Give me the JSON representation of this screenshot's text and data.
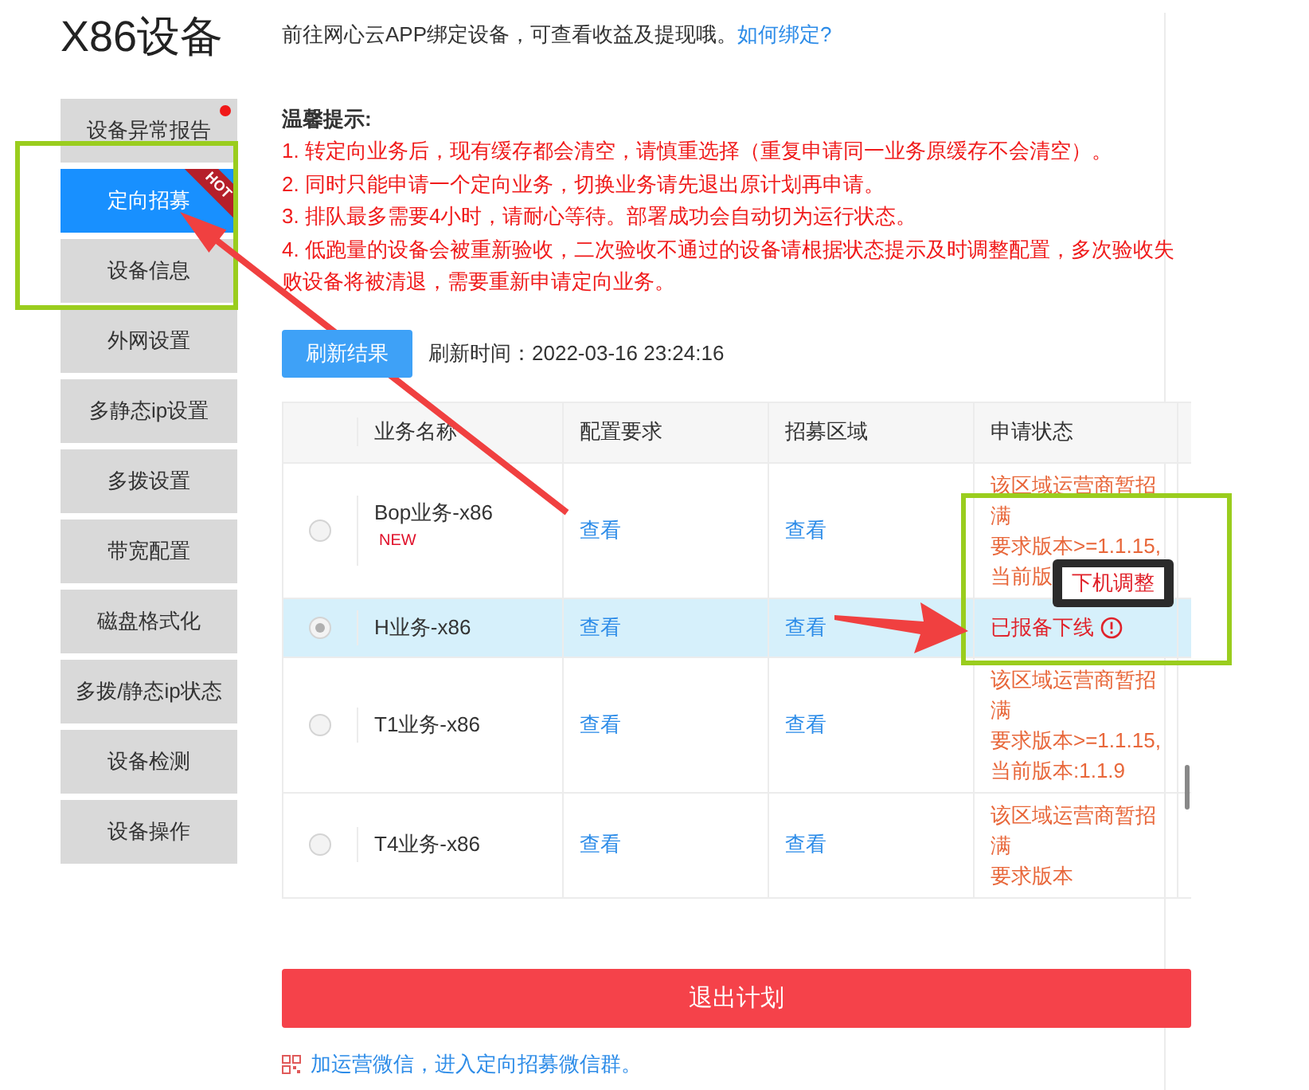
{
  "title": "X86设备",
  "intro": {
    "text": "前往网心云APP绑定设备，可查看收益及提现哦。",
    "link": "如何绑定?"
  },
  "sidebar": {
    "items": [
      {
        "label": "设备异常报告",
        "selected": false,
        "alert": true
      },
      {
        "label": "定向招募",
        "selected": true,
        "alert": false,
        "badge": "HOT"
      },
      {
        "label": "设备信息",
        "selected": false,
        "alert": false
      },
      {
        "label": "外网设置",
        "selected": false,
        "alert": false
      },
      {
        "label": "多静态ip设置",
        "selected": false,
        "alert": false
      },
      {
        "label": "多拨设置",
        "selected": false,
        "alert": false
      },
      {
        "label": "带宽配置",
        "selected": false,
        "alert": false
      },
      {
        "label": "磁盘格式化",
        "selected": false,
        "alert": false
      },
      {
        "label": "多拨/静态ip状态",
        "selected": false,
        "alert": false
      },
      {
        "label": "设备检测",
        "selected": false,
        "alert": false
      },
      {
        "label": "设备操作",
        "selected": false,
        "alert": false
      }
    ]
  },
  "tips": {
    "heading": "温馨提示:",
    "items": [
      "1. 转定向业务后，现有缓存都会清空，请慎重选择（重复申请同一业务原缓存不会清空）。",
      "2. 同时只能申请一个定向业务，切换业务请先退出原计划再申请。",
      "3. 排队最多需要4小时，请耐心等待。部署成功会自动切为运行状态。",
      "4. 低跑量的设备会被重新验收，二次验收不通过的设备请根据状态提示及时调整配置，多次验收失败设备将被清退，需要重新申请定向业务。"
    ]
  },
  "refresh": {
    "button": "刷新结果",
    "time": "刷新时间：2022-03-16 23:24:16"
  },
  "table": {
    "columns": [
      "业务名称",
      "配置要求",
      "招募区域",
      "申请状态"
    ],
    "rows": [
      {
        "selected": false,
        "name": "Bop业务-x86 $^{NEW}$",
        "config": "查看",
        "region": "查看",
        "status": {
          "kind": "warning",
          "lines": [
            "该区域运营商暂招满",
            "要求版本>=1.1.15,",
            "当前版"
          ]
        }
      },
      {
        "selected": true,
        "name": "H业务-x86",
        "config": "查看",
        "region": "查看",
        "status": {
          "kind": "offline",
          "lines": [
            "已报备下线"
          ]
        }
      },
      {
        "selected": false,
        "name": "T1业务-x86",
        "config": "查看",
        "region": "查看",
        "status": {
          "kind": "warning",
          "lines": [
            "该区域运营商暂招满",
            "要求版本>=1.1.15,",
            "当前版本:1.1.9"
          ]
        }
      },
      {
        "selected": false,
        "name": "T4业务-x86",
        "config": "查看",
        "region": "查看",
        "status": {
          "kind": "warning",
          "lines": [
            "该区域运营商暂招满",
            "要求版本"
          ]
        }
      }
    ]
  },
  "tooltip": "下机调整",
  "exit_button": "退出计划",
  "footer_link": "加运营微信，进入定向招募微信群。"
}
